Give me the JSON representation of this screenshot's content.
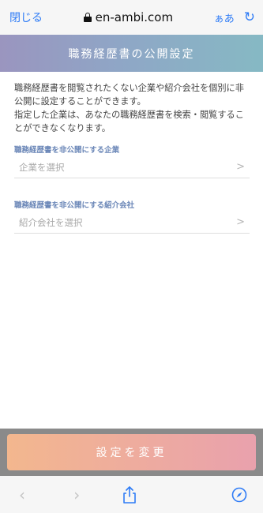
{
  "browser": {
    "close_label": "閉じる",
    "url": "en-ambi.com",
    "text_size_label": "ぁあ"
  },
  "header": {
    "title": "職務経歴書の公開設定"
  },
  "description": "職務経歴書を閲覧されたくない企業や紹介会社を個別に非公開に設定することができます。\n指定した企業は、あなたの職務経歴書を検索・閲覧することができなくなります。",
  "sections": [
    {
      "label": "職務経歴書を非公開にする企業",
      "placeholder": "企業を選択"
    },
    {
      "label": "職務経歴書を非公開にする紹介会社",
      "placeholder": "紹介会社を選択"
    }
  ],
  "submit": {
    "label": "設定を変更"
  },
  "colors": {
    "accent_blue": "#2f7cf6",
    "header_gradient_start": "#9a95bf",
    "header_gradient_end": "#86b9c4",
    "button_gradient_start": "#f3b78e",
    "button_gradient_end": "#e9a1ad",
    "label_blue": "#6a86b7"
  },
  "icons": [
    "lock-icon",
    "reload-icon",
    "chevron-right-icon",
    "back-icon",
    "forward-icon",
    "share-icon",
    "compass-icon"
  ]
}
